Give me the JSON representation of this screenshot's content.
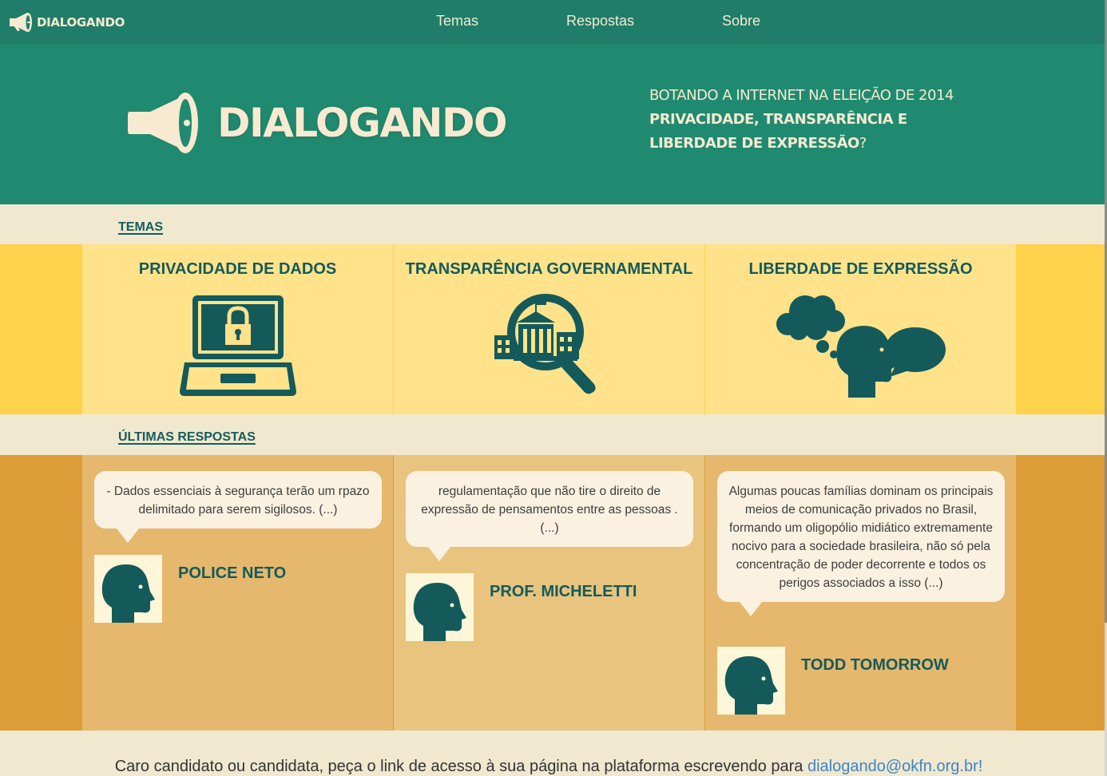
{
  "nav": {
    "logo_text": "DIALOGANDO",
    "links": [
      "Temas",
      "Respostas",
      "Sobre"
    ]
  },
  "hero": {
    "title": "DIALOGANDO",
    "tag_line1": "BOTANDO A INTERNET NA ELEIÇÃO DE 2014",
    "tag_bold": "PRIVACIDADE, TRANSPARÊNCIA E LIBERDADE DE EXPRESSÃO",
    "tag_suffix": "?"
  },
  "themes": {
    "section_title": "TEMAS",
    "items": [
      {
        "label": "PRIVACIDADE DE DADOS",
        "icon": "laptop-lock-icon"
      },
      {
        "label": "TRANSPARÊNCIA GOVERNAMENTAL",
        "icon": "magnifier-building-icon"
      },
      {
        "label": "LIBERDADE DE EXPRESSÃO",
        "icon": "head-speech-icon"
      }
    ]
  },
  "answers": {
    "section_title": "ÚLTIMAS RESPOSTAS",
    "items": [
      {
        "text": "- Dados essenciais à segurança terão um rpazo delimitado para serem sigilosos. (...)",
        "author": "POLICE NETO"
      },
      {
        "text": "regulamentação que não tire o direito de expressão de pensamentos entre as pessoas . (...)",
        "author": "PROF. MICHELETTI"
      },
      {
        "text": "Algumas poucas famílias dominam os principais meios de comunicação privados no Brasil, formando um oligopólio midiático extremamente nocivo para a sociedade brasileira, não só pela concentração de poder decorrente e todos os perigos associados a isso (...)",
        "author": "TODD TOMORROW"
      }
    ]
  },
  "footer": {
    "text": "Caro candidato ou candidata, peça o link de acesso à sua página na plataforma escrevendo para ",
    "email": "dialogando@okfn.org.br!"
  },
  "colors": {
    "nav_bg": "#1f7d69",
    "hero_bg": "#208a70",
    "cream": "#f0e8cf",
    "yellow": "#ffd24c",
    "yellow_light": "#ffe28a",
    "orange": "#dc9c37",
    "tan": "#e5b86e",
    "teal_dark": "#145a5a",
    "link": "#3f85c4"
  }
}
